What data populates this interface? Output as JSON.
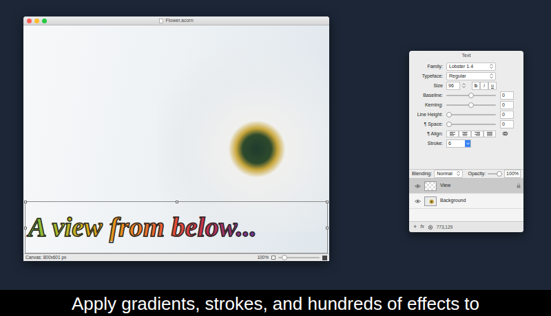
{
  "window": {
    "title": "Flower.acorn"
  },
  "canvas": {
    "text": "A view from below...",
    "selected": true
  },
  "status_bar": {
    "canvas_size": "Canvas: 800x601 px",
    "zoom": "100%",
    "zoom_level": 0.1
  },
  "inspector": {
    "title": "Text",
    "fields": [
      {
        "kind": "select",
        "label": "Family:",
        "value": "Lobster 1.4"
      },
      {
        "kind": "select",
        "label": "Typeface:",
        "value": "Regular"
      },
      {
        "kind": "size",
        "label": "Size",
        "value": "96",
        "styles": [
          {
            "label": "b",
            "selected": false
          },
          {
            "label": "i",
            "selected": false
          },
          {
            "label": "u",
            "selected": false
          }
        ]
      },
      {
        "kind": "slider",
        "label": "Baseline:",
        "value": "0",
        "level": 0.5
      },
      {
        "kind": "slider",
        "label": "Kerning:",
        "value": "0",
        "level": 0.5
      },
      {
        "kind": "slider",
        "label": "Line Height:",
        "value": "0",
        "level": 0
      },
      {
        "kind": "slider",
        "label": "¶ Space:",
        "value": "0",
        "level": 0
      },
      {
        "kind": "align",
        "label": "¶ Align:",
        "options": [
          {
            "align": "left",
            "selected": false
          },
          {
            "align": "center",
            "selected": false
          },
          {
            "align": "right",
            "selected": false
          },
          {
            "align": "justify",
            "selected": false
          }
        ]
      },
      {
        "kind": "stepper",
        "label": "Stroke:",
        "value": "6"
      }
    ],
    "blending": {
      "label": "Blending:",
      "value": "Normal"
    },
    "opacity": {
      "label": "Opacity:",
      "value": "100%",
      "level": 1
    }
  },
  "layers": [
    {
      "name": "View",
      "visible": true,
      "selected": true,
      "locked": true
    },
    {
      "name": "Background",
      "visible": true,
      "selected": false,
      "locked": false
    }
  ],
  "toolbar": {
    "add": "+",
    "fx": "fx",
    "coords": "773,129"
  },
  "caption": "Apply gradients, strokes, and hundreds of effects to"
}
